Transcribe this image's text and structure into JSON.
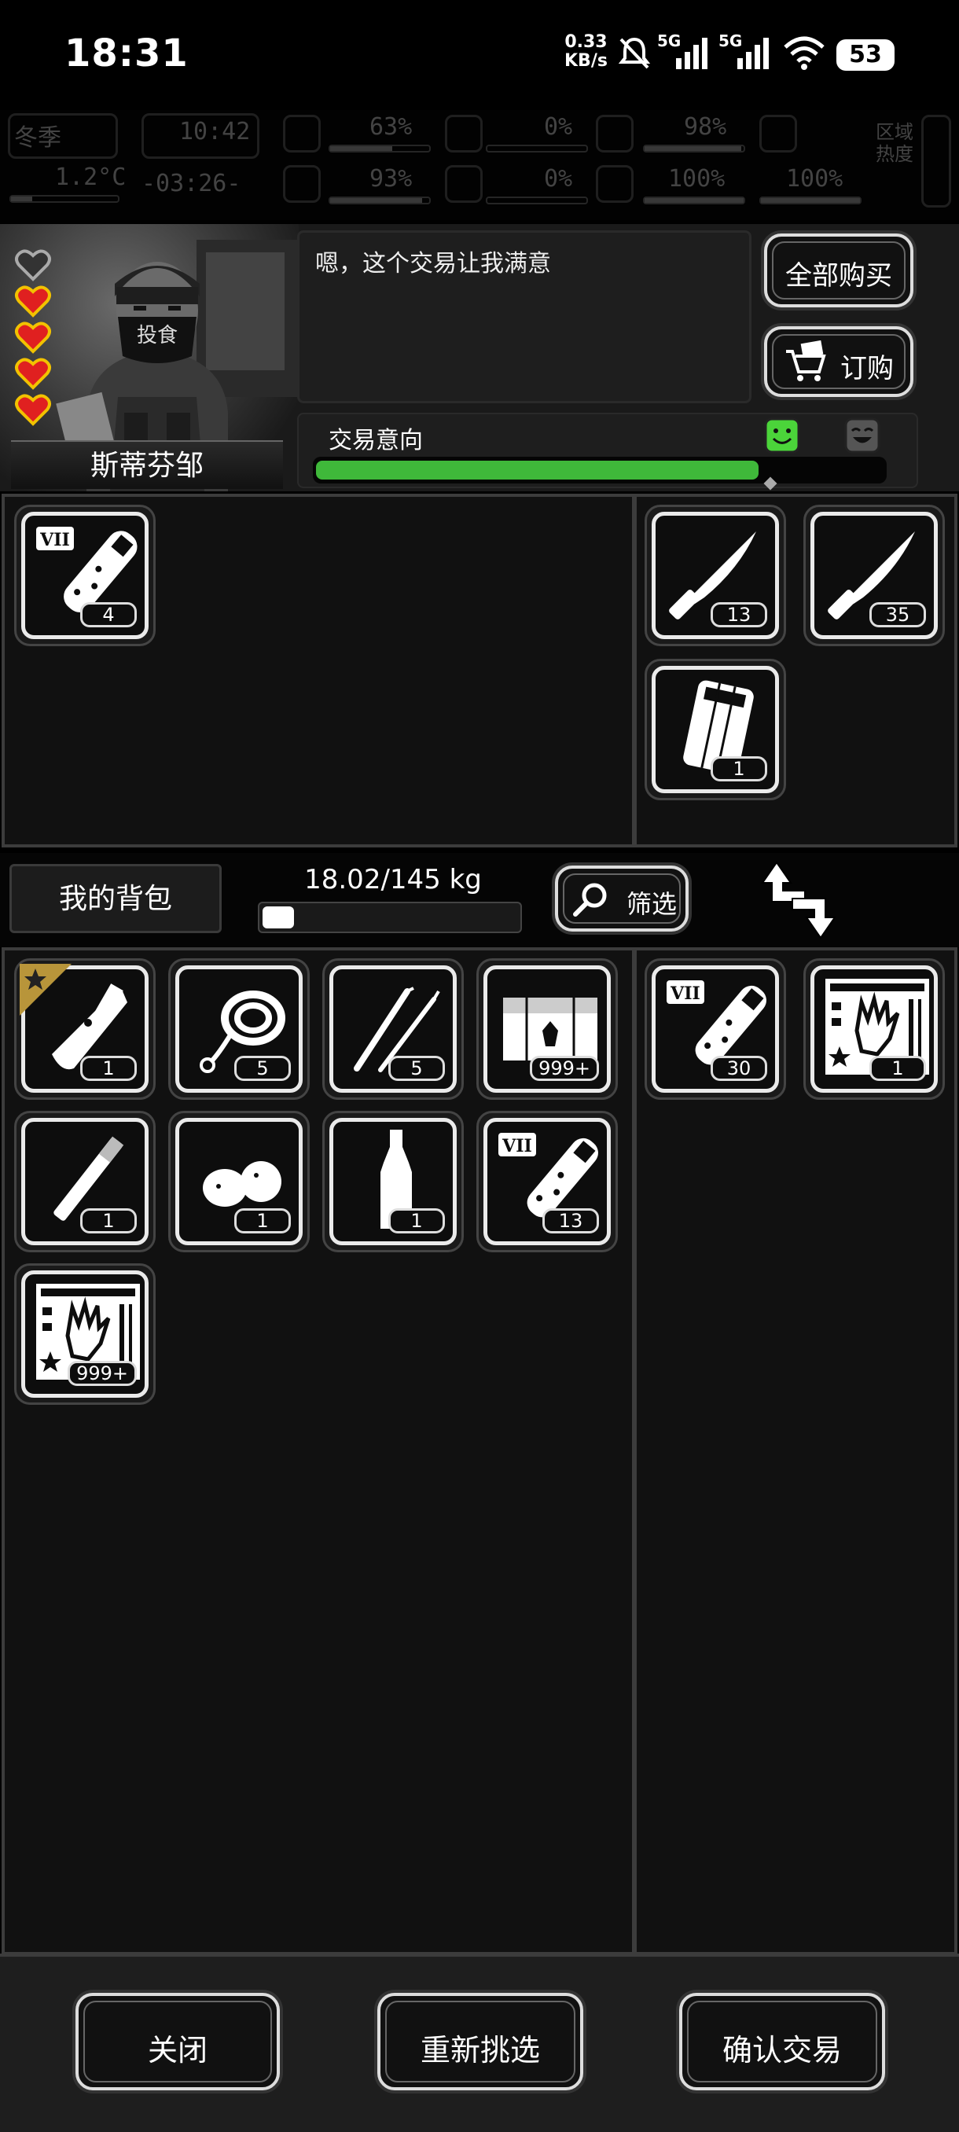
{
  "status_bar": {
    "time": "18:31",
    "net_speed_value": "0.33",
    "net_speed_unit": "KB/s",
    "signal1_label": "5G",
    "signal2_label": "5G",
    "battery": "53"
  },
  "hud": {
    "season": "冬季",
    "temperature": "1.2°C",
    "clock": "10:42",
    "countdown": "-03:26-",
    "stat1": "63%",
    "stat2": "93%",
    "stat3": "0%",
    "stat4": "0%",
    "stat5": "98%",
    "stat6": "100%",
    "stat7": "100%",
    "region_heat": "区域热度"
  },
  "trader": {
    "name": "斯蒂芬邹",
    "dialogue": "嗯，这个交易让我满意",
    "hearts_filled": 4,
    "hearts_total": 5,
    "buy_all_label": "全部购买",
    "order_label": "订购",
    "intent_label": "交易意向",
    "intent_level": 0.78,
    "colors": {
      "intent_fill": "#3fb83a",
      "heart": "#e02020"
    }
  },
  "trader_inventory": [
    {
      "icon": "vial-icon",
      "count": "4"
    }
  ],
  "trader_offer": [
    {
      "icon": "knife-icon",
      "count": "13"
    },
    {
      "icon": "knife-icon",
      "count": "35"
    },
    {
      "icon": "pack-icon",
      "count": "1"
    }
  ],
  "backpack": {
    "title": "我的背包",
    "weight": "18.02/145 kg",
    "weight_fraction": 0.124,
    "filter_label": "筛选"
  },
  "my_inventory": [
    {
      "icon": "multitool-icon",
      "count": "1",
      "starred": true
    },
    {
      "icon": "rope-icon",
      "count": "5"
    },
    {
      "icon": "lockpick-icon",
      "count": "5"
    },
    {
      "icon": "crate-icon",
      "count": "999+"
    },
    {
      "icon": "cigarette-icon",
      "count": "1"
    },
    {
      "icon": "nuts-icon",
      "count": "1"
    },
    {
      "icon": "bottle-icon",
      "count": "1"
    },
    {
      "icon": "vial-icon",
      "count": "13"
    },
    {
      "icon": "zombie-card-icon",
      "count": "999+"
    }
  ],
  "my_offer": [
    {
      "icon": "vial-icon",
      "count": "30"
    },
    {
      "icon": "zombie-card-icon",
      "count": "1"
    }
  ],
  "actions": {
    "close_label": "关闭",
    "reselect_label": "重新挑选",
    "confirm_label": "确认交易"
  }
}
